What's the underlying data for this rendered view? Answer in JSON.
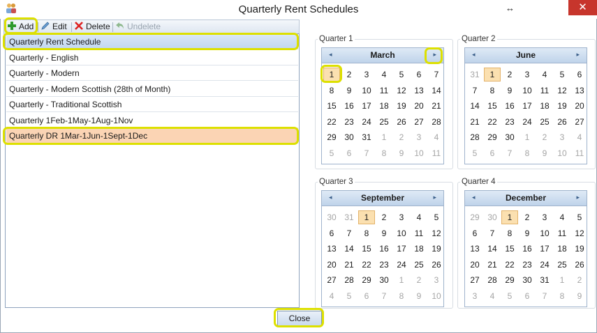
{
  "window": {
    "title": "Quarterly Rent Schedules",
    "close_glyph": "✕",
    "resize_glyph": "↔"
  },
  "toolbar": {
    "add_label": "Add",
    "edit_label": "Edit",
    "delete_label": "Delete",
    "undelete_label": "Undelete"
  },
  "schedules": [
    "Quarterly Rent Schedule",
    "Quarterly - English",
    "Quarterly - Modern",
    "Quarterly - Modern Scottish (28th of Month)",
    "Quarterly - Traditional Scottish",
    "Quarterly 1Feb-1May-1Aug-1Nov",
    "Quarterly DR 1Mar-1Jun-1Sept-1Dec"
  ],
  "selected_index": 6,
  "quarters": [
    {
      "label": "Quarter 1",
      "month": "March",
      "days": [
        [
          "1",
          "2",
          "3",
          "4",
          "5",
          "6",
          "7"
        ],
        [
          "8",
          "9",
          "10",
          "11",
          "12",
          "13",
          "14"
        ],
        [
          "15",
          "16",
          "17",
          "18",
          "19",
          "20",
          "21"
        ],
        [
          "22",
          "23",
          "24",
          "25",
          "26",
          "27",
          "28"
        ],
        [
          "29",
          "30",
          "31",
          "1",
          "2",
          "3",
          "4"
        ],
        [
          "5",
          "6",
          "7",
          "8",
          "9",
          "10",
          "11"
        ]
      ],
      "selected": [
        0,
        0
      ],
      "other_before": 0,
      "other_after_row": 4,
      "other_after_col": 3
    },
    {
      "label": "Quarter 2",
      "month": "June",
      "days": [
        [
          "31",
          "1",
          "2",
          "3",
          "4",
          "5",
          "6"
        ],
        [
          "7",
          "8",
          "9",
          "10",
          "11",
          "12",
          "13"
        ],
        [
          "14",
          "15",
          "16",
          "17",
          "18",
          "19",
          "20"
        ],
        [
          "21",
          "22",
          "23",
          "24",
          "25",
          "26",
          "27"
        ],
        [
          "28",
          "29",
          "30",
          "1",
          "2",
          "3",
          "4"
        ],
        [
          "5",
          "6",
          "7",
          "8",
          "9",
          "10",
          "11"
        ]
      ],
      "selected": [
        0,
        1
      ],
      "other_before": 1,
      "other_after_row": 4,
      "other_after_col": 3
    },
    {
      "label": "Quarter 3",
      "month": "September",
      "days": [
        [
          "30",
          "31",
          "1",
          "2",
          "3",
          "4",
          "5"
        ],
        [
          "6",
          "7",
          "8",
          "9",
          "10",
          "11",
          "12"
        ],
        [
          "13",
          "14",
          "15",
          "16",
          "17",
          "18",
          "19"
        ],
        [
          "20",
          "21",
          "22",
          "23",
          "24",
          "25",
          "26"
        ],
        [
          "27",
          "28",
          "29",
          "30",
          "1",
          "2",
          "3"
        ],
        [
          "4",
          "5",
          "6",
          "7",
          "8",
          "9",
          "10"
        ]
      ],
      "selected": [
        0,
        2
      ],
      "other_before": 2,
      "other_after_row": 4,
      "other_after_col": 4
    },
    {
      "label": "Quarter 4",
      "month": "December",
      "days": [
        [
          "29",
          "30",
          "1",
          "2",
          "3",
          "4",
          "5"
        ],
        [
          "6",
          "7",
          "8",
          "9",
          "10",
          "11",
          "12"
        ],
        [
          "13",
          "14",
          "15",
          "16",
          "17",
          "18",
          "19"
        ],
        [
          "20",
          "21",
          "22",
          "23",
          "24",
          "25",
          "26"
        ],
        [
          "27",
          "28",
          "29",
          "30",
          "31",
          "1",
          "2"
        ],
        [
          "3",
          "4",
          "5",
          "6",
          "7",
          "8",
          "9"
        ]
      ],
      "selected": [
        0,
        2
      ],
      "other_before": 2,
      "other_after_row": 4,
      "other_after_col": 5
    }
  ],
  "footer": {
    "close_label": "Close"
  },
  "colors": {
    "highlight": "#dde000",
    "selected_row": "#fbd4b4",
    "title_row": "#c9dcf3",
    "close_button": "#c7352c"
  },
  "icons": {
    "add": "plus-icon",
    "edit": "pencil-icon",
    "delete": "delete-x-icon",
    "undelete": "undo-arrow-icon"
  }
}
